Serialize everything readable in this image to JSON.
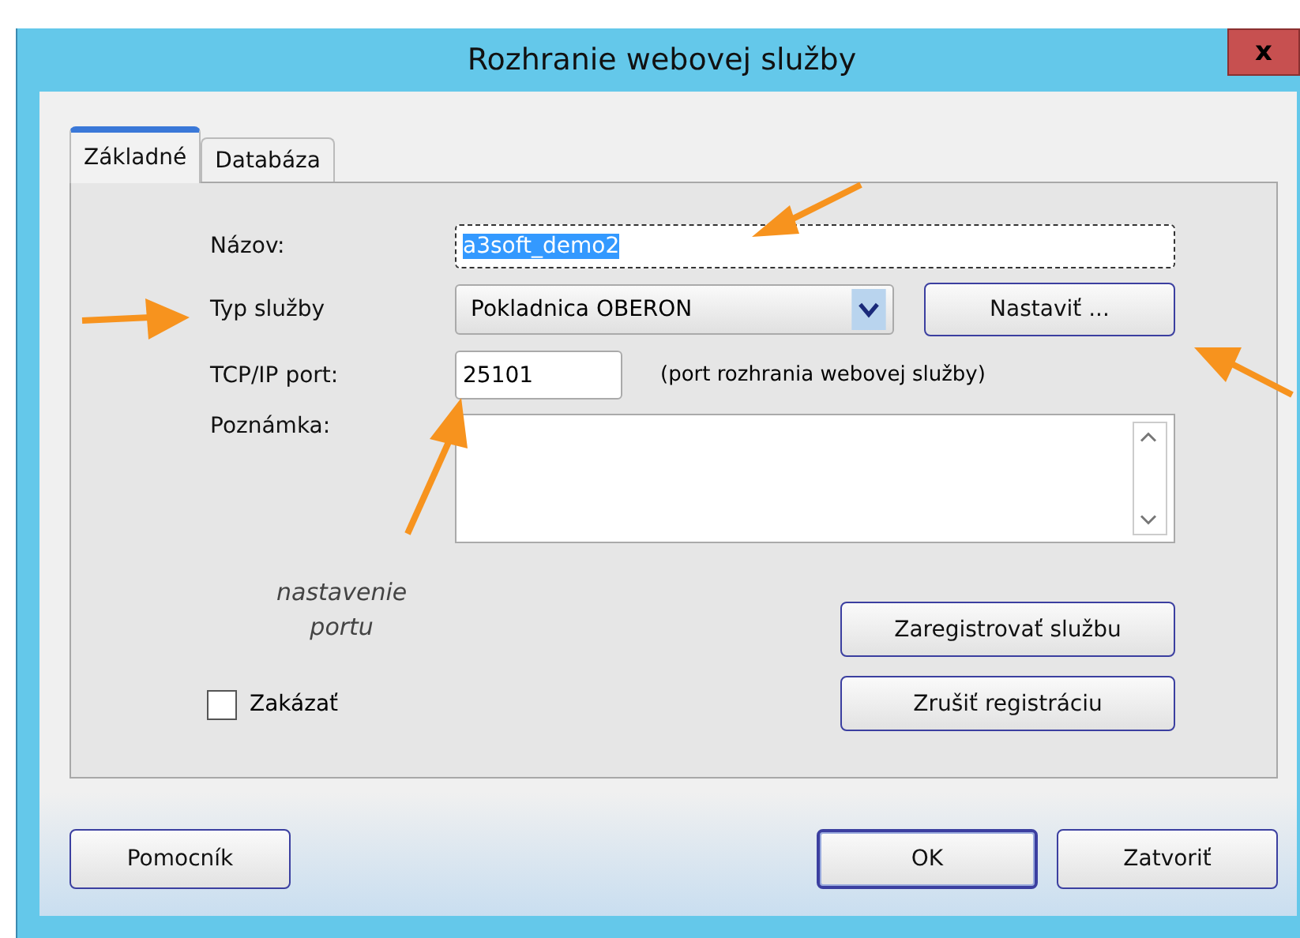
{
  "window": {
    "title": "Rozhranie webovej služby",
    "close": "x"
  },
  "tabs": [
    {
      "label": "Základné",
      "selected": true
    },
    {
      "label": "Databáza",
      "selected": false
    }
  ],
  "form": {
    "name_label": "Názov:",
    "name_value": "a3soft_demo2",
    "type_label": "Typ služby",
    "type_value": "Pokladnica OBERON",
    "settings_button": "Nastaviť ...",
    "port_label": "TCP/IP port:",
    "port_value": "25101",
    "port_hint": "(port rozhrania webovej služby)",
    "note_label": "Poznámka:",
    "annotation": [
      "nastavenie",
      "portu"
    ],
    "register_button": "Zaregistrovať službu",
    "unregister_button": "Zrušiť registráciu",
    "disable": {
      "label": "Zakázať",
      "checked": false
    }
  },
  "buttons": [
    {
      "label": "Pomocník",
      "kind": "left"
    },
    {
      "label": "OK",
      "kind": "right"
    },
    {
      "label": "Zatvoriť",
      "kind": "right"
    }
  ]
}
